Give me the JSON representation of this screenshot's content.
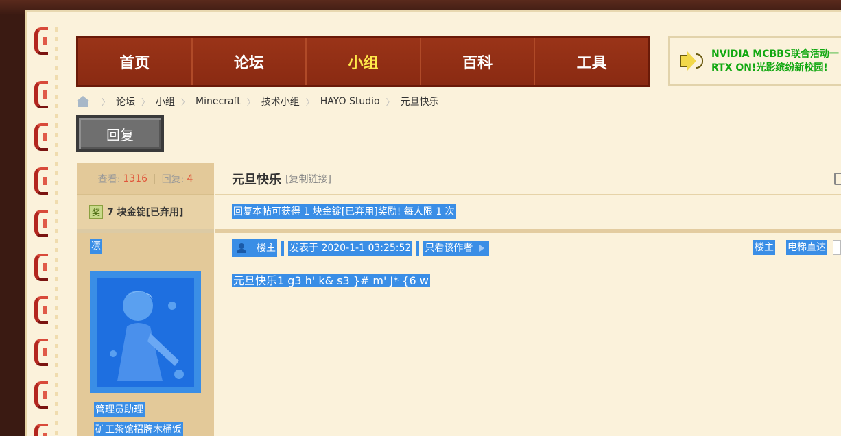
{
  "nav": {
    "items": [
      {
        "label": "首页"
      },
      {
        "label": "论坛"
      },
      {
        "label": "小组"
      },
      {
        "label": "百科"
      },
      {
        "label": "工具"
      }
    ],
    "active_index": 2
  },
  "notice": {
    "line1": "NVIDIA MCBBS联合活动一",
    "line2": "RTX ON!光影缤纷新校园!"
  },
  "breadcrumb": {
    "items": [
      "论坛",
      "小组",
      "Minecraft",
      "技术小组",
      "HAYO Studio",
      "元旦快乐"
    ]
  },
  "reply_button": {
    "label": "回复"
  },
  "stats": {
    "views_label": "查看:",
    "views": "1316",
    "replies_label": "回复:",
    "replies": "4"
  },
  "reward": {
    "icon_text": "奖",
    "label": "7 块金锭[已弃用]",
    "banner": "回复本帖可获得 1 块金锭[已弃用]奖励! 每人限 1 次"
  },
  "author": {
    "name": "凛",
    "group1": "管理员助理",
    "group2": "矿工茶馆招牌木桶饭"
  },
  "thread": {
    "title": "元旦快乐",
    "copy_link": "[复制链接]"
  },
  "post": {
    "floor_label": "楼主",
    "posted_at": "发表于 2020-1-1 03:25:52",
    "only_author": "只看该作者",
    "floor_right": "楼主",
    "elevator": "电梯直达",
    "content": "元旦快乐1 g3 h' k& s3 }# m' J* {6 w"
  },
  "colors": {
    "nav_bg": "#8a2a12",
    "nav_active": "#ffe94a",
    "notice_text": "#11a811",
    "selection": "#3a8ee6",
    "page_bg": "#fbf2db",
    "sidebar_bg": "#e3c999"
  }
}
